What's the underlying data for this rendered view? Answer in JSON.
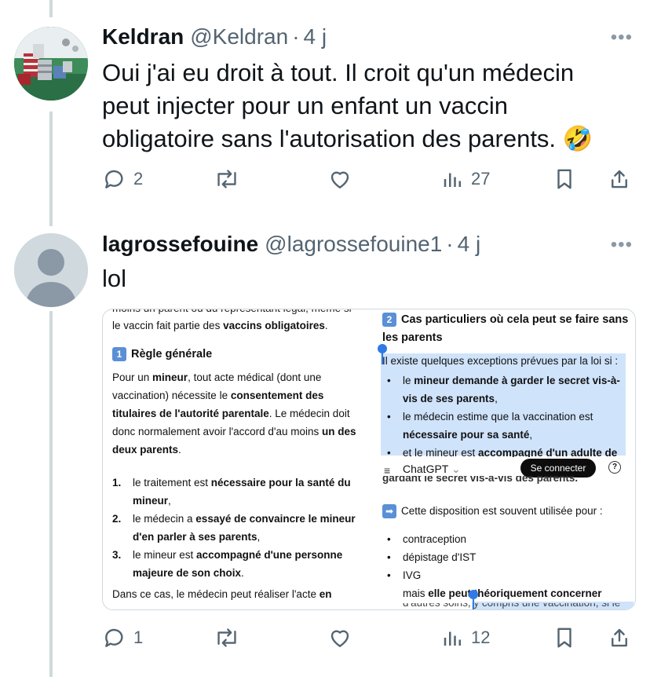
{
  "tweets": [
    {
      "display_name": "Keldran",
      "handle": "@Keldran",
      "separator": "·",
      "time": "4 j",
      "text_lines": [
        "Oui j'ai eu droit à tout. Il croit qu'un médecin",
        "peut injecter pour un enfant un vaccin",
        "obligatoire sans l'autorisation des parents. 🤣"
      ],
      "replies": "2",
      "retweets": "",
      "likes": "",
      "views": "27",
      "more": "•••"
    },
    {
      "display_name": "lagrossefouine",
      "handle": "@lagrossefouine1",
      "separator": "·",
      "time": "4 j",
      "text_lines": [
        "lol"
      ],
      "replies": "1",
      "retweets": "",
      "likes": "",
      "views": "12",
      "more": "•••"
    }
  ],
  "media": {
    "left": {
      "cut_top": "moins un parent ou du représentant légal, même si",
      "line1a": "le vaccin fait partie des ",
      "line1b": "vaccins obligatoires",
      "line1c": ".",
      "section_badge": "1",
      "section_title": "Règle générale",
      "p1": [
        "Pour un ",
        "mineur",
        ", tout acte médical (dont une"
      ],
      "p2": [
        "vaccination) nécessite le ",
        "consentement des"
      ],
      "p3": [
        "titulaires de l'autorité parentale",
        ". Le médecin doit"
      ],
      "p4": [
        "donc normalement avoir l'accord d'au moins ",
        "un des"
      ],
      "p5": [
        "deux parents",
        "."
      ],
      "list": [
        {
          "n": "1.",
          "a": "le traitement est ",
          "b": "nécessaire pour la santé du",
          "c": "mineur",
          "d": ","
        },
        {
          "n": "2.",
          "a": "le médecin a ",
          "b": "essayé de convaincre le mineur",
          "c": "d'en parler à ses parents",
          "d": ","
        },
        {
          "n": "3.",
          "a": "le mineur est ",
          "b": "accompagné d'une personne",
          "c": "majeure de son choix",
          "d": "."
        }
      ],
      "last": [
        "Dans ce cas, le médecin peut réaliser l'acte ",
        "en"
      ]
    },
    "right": {
      "section_badge": "2",
      "title_line1": "Cas particuliers où cela peut se faire sans",
      "title_line2": "les parents",
      "intro": "Il existe quelques exceptions prévues par la loi si :",
      "bullets": [
        {
          "a": "le ",
          "b": "mineur demande à garder le secret vis-à-",
          "c": "vis de ses parents",
          "d": ","
        },
        {
          "a": "le médecin estime que la vaccination est",
          "b": "",
          "c": "nécessaire pour sa santé",
          "d": ","
        },
        {
          "a": "et le mineur est ",
          "b": "accompagné d'un adulte de",
          "c": "",
          "d": ""
        }
      ],
      "app_name": "ChatGPT",
      "app_chevron": "⌄",
      "connect": "Se connecter",
      "help": "?",
      "cut_line": "gardant le secret vis-à-vis des parents.",
      "disposition": "Cette disposition est souvent utilisée pour :",
      "uses": [
        "contraception",
        "dépistage d'IST",
        "IVG"
      ],
      "last_a": "mais ",
      "last_b": "elle peut théoriquement concerner",
      "last_c": "d'autres soins, y compris une vaccination, si le"
    }
  }
}
